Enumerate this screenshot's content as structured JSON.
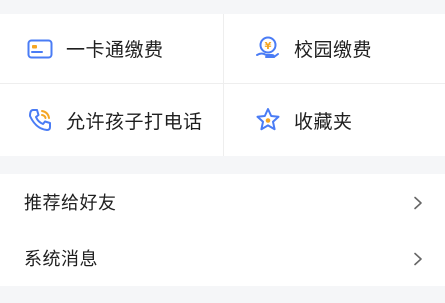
{
  "grid": {
    "items": [
      {
        "label": "一卡通缴费",
        "icon": "card-icon"
      },
      {
        "label": "校园缴费",
        "icon": "payment-hand-icon"
      },
      {
        "label": "允许孩子打电话",
        "icon": "phone-icon"
      },
      {
        "label": "收藏夹",
        "icon": "star-icon"
      }
    ]
  },
  "list": {
    "items": [
      {
        "label": "推荐给好友"
      },
      {
        "label": "系统消息"
      }
    ]
  },
  "colors": {
    "accent_blue": "#4a7cf5",
    "accent_orange": "#f5a623",
    "text": "#1f1f1f",
    "background": "#f5f6f8"
  }
}
